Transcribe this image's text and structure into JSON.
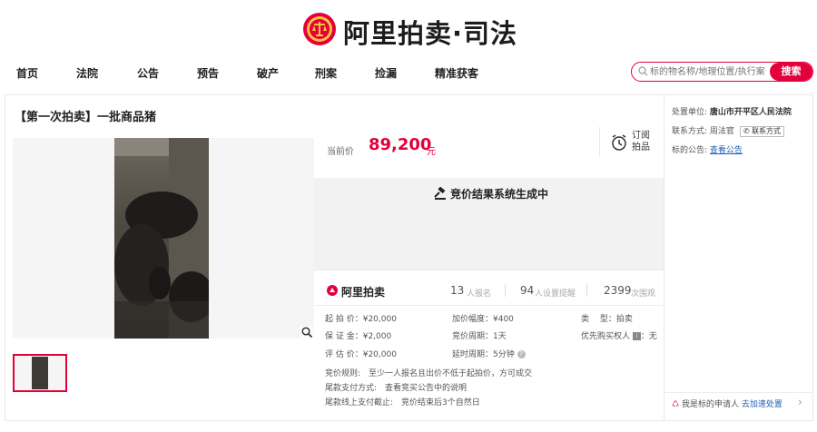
{
  "brand": {
    "name": "阿里拍卖·司法",
    "accent": "#e4003a"
  },
  "nav": {
    "items": [
      "首页",
      "法院",
      "公告",
      "预告",
      "破产",
      "刑案",
      "捡漏",
      "精准获客"
    ]
  },
  "search": {
    "placeholder": "标的物名称/地理位置/执行案号",
    "button": "搜索"
  },
  "item": {
    "title": "【第一次拍卖】一批商品猪",
    "current_price_label": "当前价",
    "current_price": "89,200",
    "price_unit": "元",
    "subscribe": "订阅拍品",
    "status": "竞价结果系统生成中",
    "platform": "阿里拍卖"
  },
  "stats": [
    {
      "num": "13",
      "label": "人报名"
    },
    {
      "num": "94",
      "label": "人设置提醒"
    },
    {
      "num": "2399",
      "label": "次围观"
    }
  ],
  "details": {
    "start_price": "起 拍 价：¥20,000",
    "deposit": "保 证 金：¥2,000",
    "appraisal": "评 估 价：¥20,000",
    "increment": "加价幅度：¥400",
    "cycle": "竞价周期：1天",
    "delay": "延时周期：5分钟",
    "type_label": "类　 型：",
    "type_value": "拍卖",
    "priority_label": "优先购买权人",
    "priority_value": "：无"
  },
  "rules": {
    "rule": "竞价规则:　至少一人报名且出价不低于起拍价，方可成交",
    "payment": "尾款支付方式:　查看竞买公告中的说明",
    "deadline": "尾款线上支付截止:　竞价结束后3个自然日"
  },
  "side": {
    "unit_label": "处置单位:",
    "unit_value": "唐山市开平区人民法院",
    "contact_label": "联系方式:",
    "contact_name": "周法官",
    "contact_button": "联系方式",
    "notice_label": "标的公告:",
    "notice_link": "查看公告"
  },
  "applicant": {
    "text": "我是标的申请人",
    "link": "去加速处置"
  }
}
